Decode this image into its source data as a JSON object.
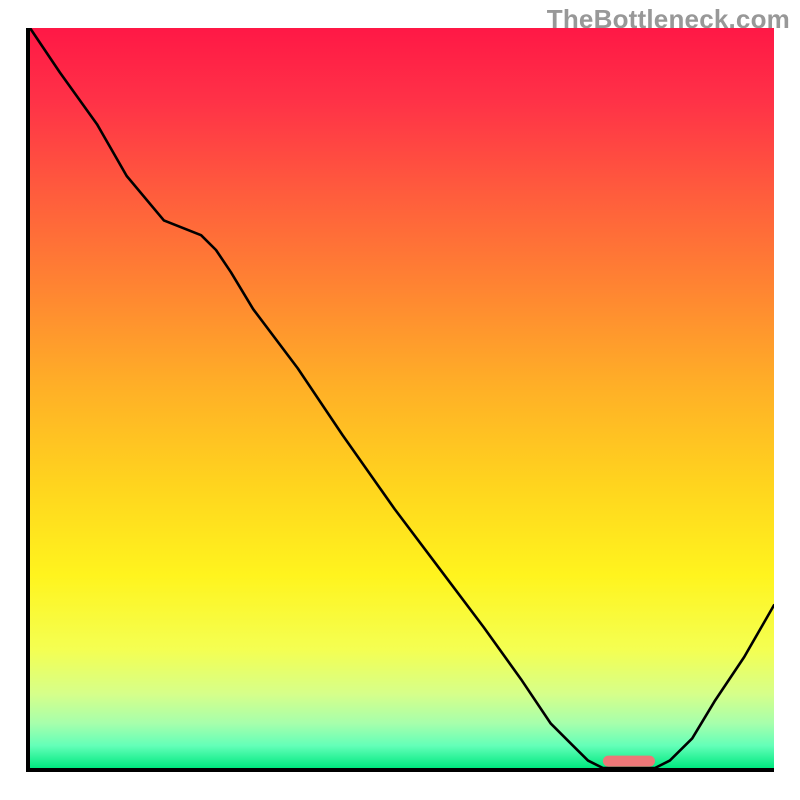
{
  "watermark": "TheBottleneck.com",
  "colors": {
    "axis": "#000000",
    "curve": "#000000",
    "marker": "#ed7777",
    "watermark_text": "#989898",
    "gradient_stops": [
      {
        "offset": 0.0,
        "color": "#ff1846"
      },
      {
        "offset": 0.1,
        "color": "#ff3247"
      },
      {
        "offset": 0.22,
        "color": "#ff5b3d"
      },
      {
        "offset": 0.35,
        "color": "#ff8432"
      },
      {
        "offset": 0.48,
        "color": "#ffae27"
      },
      {
        "offset": 0.62,
        "color": "#ffd51e"
      },
      {
        "offset": 0.74,
        "color": "#fff41e"
      },
      {
        "offset": 0.84,
        "color": "#f4ff52"
      },
      {
        "offset": 0.9,
        "color": "#d6ff8a"
      },
      {
        "offset": 0.94,
        "color": "#a6ffac"
      },
      {
        "offset": 0.97,
        "color": "#63ffb8"
      },
      {
        "offset": 1.0,
        "color": "#00e97f"
      }
    ]
  },
  "chart_data": {
    "type": "line",
    "title": "",
    "xlabel": "",
    "ylabel": "",
    "xlim": [
      0,
      100
    ],
    "ylim": [
      0,
      100
    ],
    "x": [
      0,
      4,
      9,
      13,
      18,
      23,
      25,
      27,
      30,
      36,
      42,
      49,
      55,
      61,
      66,
      70,
      73,
      75,
      77,
      79,
      81,
      84,
      86,
      89,
      92,
      96,
      100
    ],
    "values": [
      100,
      94,
      87,
      80,
      74,
      72,
      70,
      67,
      62,
      54,
      45,
      35,
      27,
      19,
      12,
      6,
      3,
      1,
      0,
      0,
      0,
      0,
      1,
      4,
      9,
      15,
      22
    ],
    "marker": {
      "x_start": 77,
      "x_end": 84,
      "y": 1
    },
    "notes": "Values are read off a normalized 0-100 axis in both directions; the curve reaches its minimum (near 0) around x≈77-84, marked by a pink rounded bar at the bottom."
  }
}
